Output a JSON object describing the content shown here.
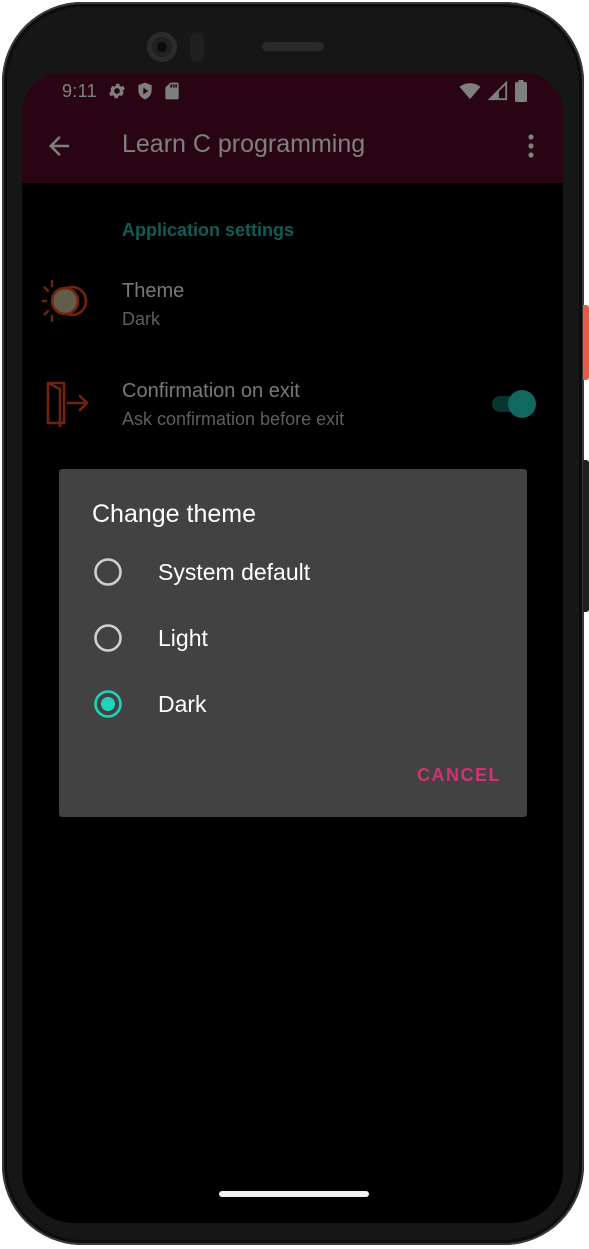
{
  "status_bar": {
    "time": "9:11",
    "left_icons": [
      "gear-icon",
      "shield-play-icon",
      "sd-card-icon"
    ],
    "right_icons": [
      "wifi-icon",
      "cell-signal-icon",
      "battery-icon"
    ]
  },
  "app_bar": {
    "title": "Learn C programming",
    "back_icon": "arrow-back-icon",
    "menu_icon": "more-vert-icon"
  },
  "settings": {
    "section_title": "Application settings",
    "items": [
      {
        "title": "Theme",
        "summary": "Dark",
        "icon": "theme-sun-icon"
      },
      {
        "title": "Confirmation on exit",
        "summary": "Ask confirmation before exit",
        "icon": "exit-door-icon",
        "switch_on": true
      }
    ]
  },
  "dialog": {
    "title": "Change theme",
    "options": [
      {
        "label": "System default",
        "selected": false
      },
      {
        "label": "Light",
        "selected": false
      },
      {
        "label": "Dark",
        "selected": true
      }
    ],
    "cancel_label": "CANCEL"
  },
  "colors": {
    "app_bar": "#520a26",
    "accent_teal": "#1fd3be",
    "dialog_bg": "#424242",
    "cancel_pink": "#d2336f",
    "icon_orange": "#e0481c"
  }
}
